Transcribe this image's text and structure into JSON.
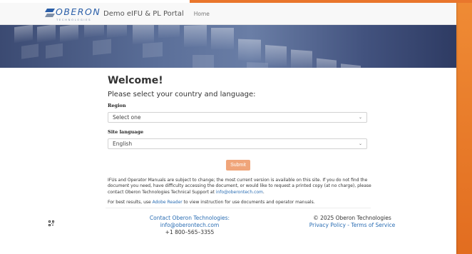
{
  "brand": {
    "logo_text": "OBERON",
    "logo_sub": "TECHNOLOGIES",
    "portal_title": "Demo eIFU & PL Portal",
    "nav_home": "Home",
    "accent_color": "#e9762c"
  },
  "main": {
    "welcome": "Welcome!",
    "subtitle": "Please select your country and language:",
    "region_label": "Region",
    "region_value": "Select one",
    "language_label": "Site language",
    "language_value": "English",
    "submit_label": "Submit",
    "para_text": "IFUs and Operator Manuals are subject to change; the most current version is available on this site. If you do not find the document you need, have difficulty accessing the document, or would like to request a printed copy (at no charge), please contact Oberon Technologies Technical Support at ",
    "para_email": "info@oberontech.com",
    "para_end": ".",
    "reader_prefix": "For best results, use ",
    "reader_link": "Adobe Reader",
    "reader_suffix": " to view instruction for use documents and operator manuals."
  },
  "footer": {
    "contact_label": "Contact Oberon Technologies:",
    "contact_email": "info@oberontech.com",
    "contact_phone": "+1 800–565–3355",
    "copyright": "© 2025 Oberon Technologies",
    "privacy_link": "Privacy Policy",
    "separator": " - ",
    "terms_link": "Terms of Service"
  }
}
